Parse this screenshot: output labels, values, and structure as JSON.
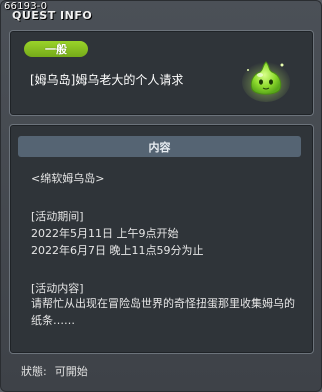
{
  "window": {
    "quest_id": "66193-0",
    "title": "QUEST INFO"
  },
  "quest": {
    "category_badge": "一般",
    "name": "[姆乌岛]姆乌老大的个人请求",
    "icon": "green-slime-icon"
  },
  "content": {
    "header": "内容",
    "place": "<绵软姆乌岛>",
    "period_label": "[活动期间]",
    "period_start": "2022年5月11日 上午9点开始",
    "period_end": "2022年6月7日 晚上11点59分为止",
    "detail_label": "[活动内容]",
    "detail_text": "请帮忙从出现在冒险岛世界的奇怪扭蛋那里收集姆乌的纸条……"
  },
  "status": {
    "label": "狀態:",
    "value": "可開始"
  },
  "colors": {
    "badge_green": "#8cc523",
    "panel_bg": "#2f3439",
    "header_bg": "#556473"
  }
}
